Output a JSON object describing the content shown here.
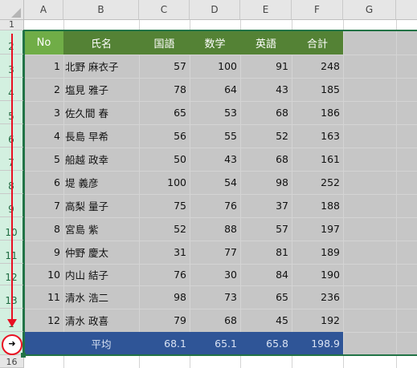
{
  "columns": [
    "A",
    "B",
    "C",
    "D",
    "E",
    "F",
    "G"
  ],
  "rows": [
    "1",
    "2",
    "3",
    "4",
    "5",
    "6",
    "7",
    "8",
    "9",
    "10",
    "11",
    "12",
    "13",
    "1",
    "16"
  ],
  "table": {
    "headers": [
      "No",
      "氏名",
      "国語",
      "数学",
      "英語",
      "合計"
    ],
    "records": [
      [
        "1",
        "北野 麻衣子",
        "57",
        "100",
        "91",
        "248"
      ],
      [
        "2",
        "塩見 雅子",
        "78",
        "64",
        "43",
        "185"
      ],
      [
        "3",
        "佐久間 春",
        "65",
        "53",
        "68",
        "186"
      ],
      [
        "4",
        "長島 早希",
        "56",
        "55",
        "52",
        "163"
      ],
      [
        "5",
        "船越 政幸",
        "50",
        "43",
        "68",
        "161"
      ],
      [
        "6",
        "堤 義彦",
        "100",
        "54",
        "98",
        "252"
      ],
      [
        "7",
        "高梨 量子",
        "75",
        "76",
        "37",
        "188"
      ],
      [
        "8",
        "宮島 紫",
        "52",
        "88",
        "57",
        "197"
      ],
      [
        "9",
        "仲野 慶太",
        "31",
        "77",
        "81",
        "189"
      ],
      [
        "10",
        "内山 結子",
        "76",
        "30",
        "84",
        "190"
      ],
      [
        "11",
        "清水 浩二",
        "98",
        "73",
        "65",
        "236"
      ],
      [
        "12",
        "清水 政喜",
        "79",
        "68",
        "45",
        "192"
      ]
    ],
    "average": {
      "label": "平均",
      "values": [
        "68.1",
        "65.1",
        "65.8",
        "198.9"
      ]
    }
  },
  "cursor_icon": "row-select-cursor-icon",
  "colors": {
    "header_green": "#548235",
    "no_green": "#70ad47",
    "avg_blue": "#2f5597",
    "selection": "#c6c6c6",
    "annotation_red": "#e81123",
    "excel_green": "#217346"
  }
}
